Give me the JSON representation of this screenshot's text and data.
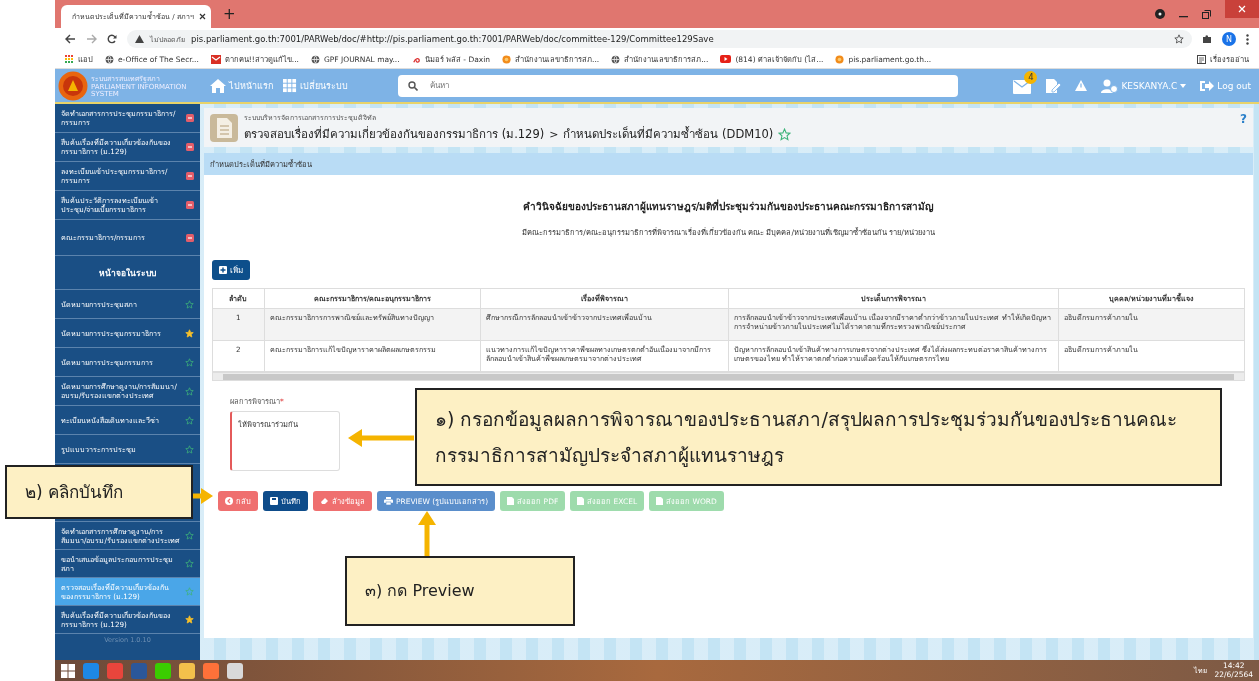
{
  "browser": {
    "tab_title": "กำหนดประเด็นที่มีความซ้ำซ้อน / สภาฯ",
    "new_tab": "+",
    "not_secure": "ไม่ปลอดภัย",
    "url": "pis.parliament.go.th:7001/PARWeb/doc/#http://pis.parliament.go.th:7001/PARWeb/doc/committee-129/Committee129Save",
    "profile": "N",
    "reading_list": "เรื่องรออ่าน",
    "bookmarks": [
      "แอป",
      "e-Office of The Secr...",
      "ตากคน!!สาวดูแก้ไข...",
      "GPF JOURNAL may...",
      "นิมอร์ พลัส - Daxin",
      "สำนักงานเลขาธิการสภ...",
      "สำนักงานเลขาธิการสภ...",
      "(814) ศาลเจ้าจัดกับ (ไส...",
      "pis.parliament.go.th..."
    ]
  },
  "header": {
    "logo_title": "ระบบสารสนเทศรัฐสภา",
    "logo_subtitle": "PARLIAMENT INFORMATION SYSTEM",
    "home": "ไปหน้าแรก",
    "switch_system": "เปลี่ยนระบบ",
    "search_placeholder": "ค้นหา",
    "mail_count": "4",
    "user": "KESKANYA.C",
    "logout": "Log out"
  },
  "sidebar": {
    "sections": [
      {
        "label": "จัดทำเอกสารการประชุมกรรมาธิการ/กรรมการ"
      },
      {
        "label": "สืบค้นเรื่องที่มีความเกี่ยวข้องกันของกรรมาธิการ (ม.129)"
      },
      {
        "label": "ลงทะเบียนเข้าประชุมกรรมาธิการ/กรรมการ"
      },
      {
        "label": "สืบค้นประวัติการลงทะเบียนเข้าประชุม/จ่ายเบี้ยกรรมาธิการ"
      },
      {
        "label": "คณะกรรมาธิการ/กรรมการ"
      }
    ],
    "screens_heading": "หน้าจอในระบบ",
    "screens": [
      {
        "label": "นัดหมายการประชุมสภา",
        "favorite": false,
        "selected": false
      },
      {
        "label": "นัดหมายการประชุมกรรมาธิการ",
        "favorite": true,
        "selected": false
      },
      {
        "label": "นัดหมายการประชุมกรรมการ",
        "favorite": false,
        "selected": false
      },
      {
        "label": "นัดหมายการศึกษาดูงาน/การสัมมนา/อบรม/รับรองแขกต่างประเทศ",
        "favorite": false,
        "selected": false
      },
      {
        "label": "ทะเบียนหนังสือเดินทางและวีซ่า",
        "favorite": false,
        "selected": false
      },
      {
        "label": "รูปแบบวาระการประชุม",
        "favorite": false,
        "selected": false
      }
    ],
    "screens_more": [
      {
        "label": "จัดทำเอกสารการศึกษาดูงาน/การสัมมนา/อบรม/รับรองแขกต่างประเทศ",
        "favorite": false,
        "selected": false
      },
      {
        "label": "ขอนำเสนอข้อมูลประกอบการประชุมสภา",
        "favorite": false,
        "selected": false
      },
      {
        "label": "ตรวจสอบเรื่องที่มีความเกี่ยวข้องกันของกรรมาธิการ (ม.129)",
        "favorite": false,
        "selected": true
      },
      {
        "label": "สืบค้นเรื่องที่มีความเกี่ยวข้องกันของกรรมาธิการ (ม.129)",
        "favorite": true,
        "selected": false
      }
    ],
    "version": "Version 1.0.10"
  },
  "page": {
    "system": "ระบบบริหารจัดการเอกสารการประชุมดิจิทัล",
    "breadcrumb": [
      "ตรวจสอบเรื่องที่มีความเกี่ยวข้องกันของกรรมาธิการ (ม.129)",
      "กำหนดประเด็นที่มีความซ้ำซ้อน (DDM10)"
    ],
    "separator": ">",
    "favorite": false,
    "help": "?"
  },
  "panel": {
    "heading": "กำหนดประเด็นที่มีความซ้ำซ้อน",
    "title": "คำวินิจฉัยของประธานสภาผู้แทนราษฎร/มติที่ประชุมร่วมกันของประธานคณะกรรมาธิการสามัญ",
    "subtitle": "มีคณะกรรมาธิการ/คณะอนุกรรมาธิการที่พิจารณาเรื่องที่เกี่ยวข้องกัน คณะ มีบุคคล/หน่วยงานที่เชิญมาซ้ำซ้อนกัน ราย/หน่วยงาน",
    "add_button": "เพิ่ม",
    "table": {
      "columns": [
        "ลำดับ",
        "คณะกรรมาธิการ/คณะอนุกรรมาธิการ",
        "เรื่องที่พิจารณา",
        "ประเด็นการพิจารณา",
        "บุคคล/หน่วยงานที่มาชี้แจง"
      ],
      "rows": [
        [
          "1",
          "คณะกรรมาธิการการพาณิชย์และทรัพย์สินทางปัญญา",
          "ศึกษากรณีการลักลอบนำเข้าข้าวจากประเทศเพื่อนบ้าน",
          "การลักลอบนำเข้าข้าวจากประเทศเพื่อนบ้าน เนื่องจากมีราคาต่ำกว่าข้าวภายในประเทศ ทำให้เกิดปัญหาการจำหน่ายข้าวภายในประเทศไม่ได้ราคาตามที่กระทรวงพาณิชย์ประกาศ",
          "อธิบดีกรมการค้าภายใน"
        ],
        [
          "2",
          "คณะกรรมาธิการแก้ไขปัญหาราคาผลิตผลเกษตรกรรม",
          "แนวทางการแก้ไขปัญหาราคาพืชผลทางเกษตรตกต่ำอันเนื่องมาจากมีการลักลอบนำเข้าสินค้าพืชผลเกษตรมาจากต่างประเทศ",
          "ปัญหาการลักลอบนำเข้าสินค้าทางการเกษตรจากต่างประเทศ ซึ่งได้ส่งผลกระทบต่อราคาสินค้าทางการเกษตรของไทย ทำให้ราคาตกต่ำก่อความเดือดร้อนให้กับเกษตรกรไทย",
          "อธิบดีกรมการค้าภายใน"
        ]
      ]
    },
    "result_field": {
      "label": "ผลการพิจารณา",
      "required_mark": "*",
      "value": "ให้พิจารณาร่วมกัน"
    },
    "buttons": [
      {
        "label": "กลับ",
        "kind": "back",
        "enabled": true
      },
      {
        "label": "บันทึก",
        "kind": "save",
        "enabled": true
      },
      {
        "label": "ล้างข้อมูล",
        "kind": "clear",
        "enabled": true
      },
      {
        "label": "PREVIEW (รูปแบบเอกสาร)",
        "kind": "preview",
        "enabled": true
      },
      {
        "label": "ส่งออก PDF",
        "kind": "export",
        "enabled": false
      },
      {
        "label": "ส่งออก EXCEL",
        "kind": "export",
        "enabled": false
      },
      {
        "label": "ส่งออก WORD",
        "kind": "export",
        "enabled": false
      }
    ]
  },
  "callouts": [
    {
      "text": "๑) กรอกข้อมูลผลการพิจารณาของประธานสภา/สรุปผลการประชุมร่วมกันของประธานคณะกรรมาธิการสามัญประจำสภาผู้แทนราษฎร",
      "kind": "left"
    },
    {
      "text": "๒) คลิกบันทึก",
      "kind": "right"
    },
    {
      "text": "๓) กด Preview",
      "kind": "up"
    }
  ],
  "taskbar": {
    "language": "ไทย",
    "time": "14:42",
    "date": "22/6/2564"
  }
}
